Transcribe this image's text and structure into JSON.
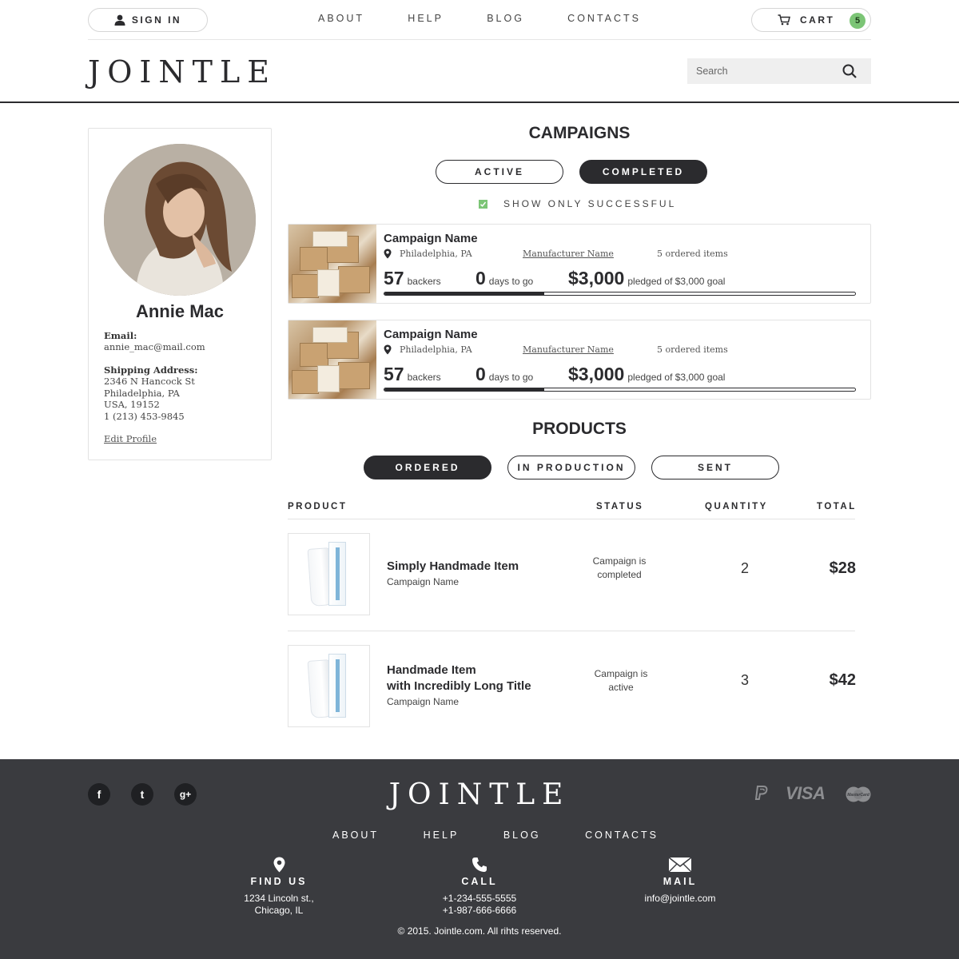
{
  "topbar": {
    "signin_label": "SIGN IN",
    "nav": [
      "ABOUT",
      "HELP",
      "BLOG",
      "CONTACTS"
    ],
    "cart_label": "CART",
    "cart_count": "5"
  },
  "header": {
    "logo": "JOINTLE",
    "search_placeholder": "Search"
  },
  "profile": {
    "name": "Annie Mac",
    "email_label": "Email:",
    "email": "annie_mac@mail.com",
    "shipping_label": "Shipping Address:",
    "address": [
      "2346 N Hancock St",
      "Philadelphia, PA",
      "USA, 19152",
      "1 (213) 453-9845"
    ],
    "edit_label": "Edit Profile"
  },
  "campaigns": {
    "title": "CAMPAIGNS",
    "tabs": [
      {
        "label": "ACTIVE",
        "selected": false
      },
      {
        "label": "COMPLETED",
        "selected": true
      }
    ],
    "filter_label": "SHOW ONLY SUCCESSFUL",
    "filter_checked": true,
    "items": [
      {
        "name": "Campaign Name",
        "location": "Philadelphia, PA",
        "manufacturer": "Manufacturer Name",
        "items": "5 ordered items",
        "backers": "57",
        "backers_label": "backers",
        "days": "0",
        "days_label": "days to go",
        "pledged": "$3,000",
        "pledged_label": "pledged of $3,000 goal",
        "progress": 0.34
      },
      {
        "name": "Campaign Name",
        "location": "Philadelphia, PA",
        "manufacturer": "Manufacturer Name",
        "items": "5 ordered items",
        "backers": "57",
        "backers_label": "backers",
        "days": "0",
        "days_label": "days to go",
        "pledged": "$3,000",
        "pledged_label": "pledged of $3,000 goal",
        "progress": 0.34
      }
    ]
  },
  "products": {
    "title": "PRODUCTS",
    "tabs": [
      {
        "label": "ORDERED",
        "selected": true
      },
      {
        "label": "IN PRODUCTION",
        "selected": false
      },
      {
        "label": "SENT",
        "selected": false
      }
    ],
    "columns": [
      "PRODUCT",
      "STATUS",
      "QUANTITY",
      "TOTAL"
    ],
    "rows": [
      {
        "name_lines": [
          "Simply Handmade Item"
        ],
        "campaign": "Campaign Name",
        "status_lines": [
          "Campaign is",
          "completed"
        ],
        "quantity": "2",
        "total": "$28"
      },
      {
        "name_lines": [
          "Handmade Item",
          "with Incredibly Long Title"
        ],
        "campaign": "Campaign Name",
        "status_lines": [
          "Campaign is",
          "active"
        ],
        "quantity": "3",
        "total": "$42"
      }
    ]
  },
  "footer": {
    "logo": "JOINTLE",
    "social": [
      "facebook-icon",
      "twitter-icon",
      "google-plus-icon"
    ],
    "social_glyphs": [
      "f",
      "t",
      "g+"
    ],
    "payments": [
      "paypal-icon",
      "VISA",
      "MasterCard"
    ],
    "nav": [
      "ABOUT",
      "HELP",
      "BLOG",
      "CONTACTS"
    ],
    "find_us": {
      "title": "FIND US",
      "lines": [
        "1234 Lincoln st.,",
        "Chicago, IL"
      ]
    },
    "call": {
      "title": "CALL",
      "lines": [
        "+1-234-555-5555",
        "+1-987-666-6666"
      ]
    },
    "mail": {
      "title": "MAIL",
      "lines": [
        "info@jointle.com"
      ]
    },
    "copyright": "© 2015. Jointle.com. All rihts reserved."
  },
  "colors": {
    "dark": "#2b2b2e",
    "accent_green": "#7cc576",
    "footer_bg": "#3a3b3f"
  }
}
